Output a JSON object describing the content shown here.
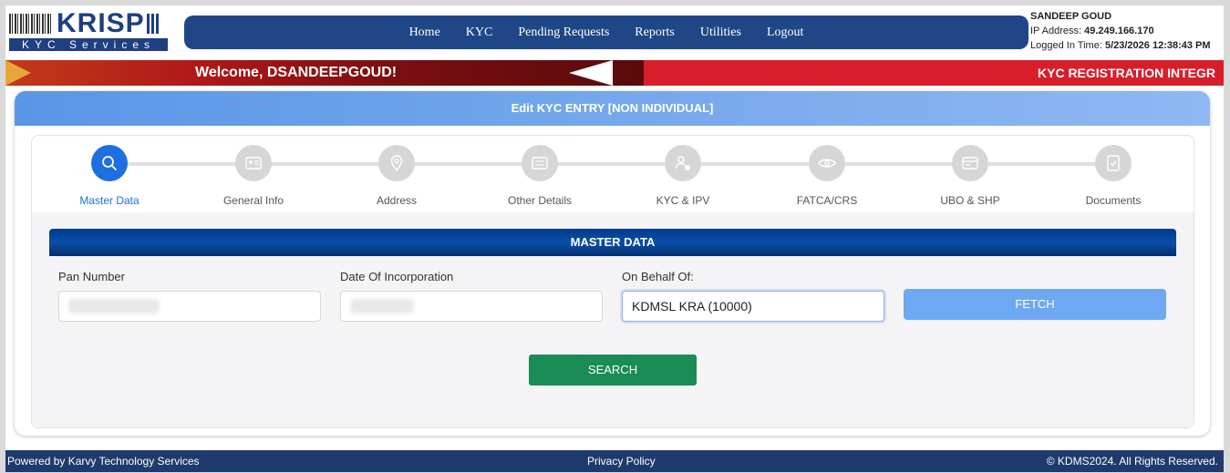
{
  "brand": {
    "logo_word": "KRISP",
    "logo_sub": "KYC Services"
  },
  "nav": {
    "items": [
      {
        "label": "Home"
      },
      {
        "label": "KYC"
      },
      {
        "label": "Pending Requests"
      },
      {
        "label": "Reports"
      },
      {
        "label": "Utilities"
      },
      {
        "label": "Logout"
      }
    ]
  },
  "user": {
    "name": "SANDEEP GOUD",
    "ip_label": "IP Address:",
    "ip_value": "49.249.166.170",
    "login_label": "Logged In Time:",
    "login_value": "5/23/2026 12:38:43 PM"
  },
  "banner": {
    "welcome": "Welcome, DSANDEEPGOUD!",
    "marquee": "KYC REGISTRATION INTEGR"
  },
  "page": {
    "title": "Edit KYC ENTRY [NON INDIVIDUAL]"
  },
  "steps": [
    {
      "label": "Master Data",
      "icon": "search-icon",
      "active": true
    },
    {
      "label": "General Info",
      "icon": "id-card-icon",
      "active": false
    },
    {
      "label": "Address",
      "icon": "location-pin-icon",
      "active": false
    },
    {
      "label": "Other Details",
      "icon": "list-icon",
      "active": false
    },
    {
      "label": "KYC & IPV",
      "icon": "user-check-icon",
      "active": false
    },
    {
      "label": "FATCA/CRS",
      "icon": "eye-icon",
      "active": false
    },
    {
      "label": "UBO & SHP",
      "icon": "card-icon",
      "active": false
    },
    {
      "label": "Documents",
      "icon": "document-check-icon",
      "active": false
    }
  ],
  "section": {
    "title": "MASTER DATA"
  },
  "form": {
    "pan_label": "Pan Number",
    "pan_value": "",
    "doi_label": "Date Of Incorporation",
    "doi_value": "",
    "behalf_label": "On Behalf Of:",
    "behalf_value": "KDMSL KRA (10000)",
    "fetch_label": "FETCH",
    "search_label": "SEARCH"
  },
  "footer": {
    "left": "Powered by Karvy Technology Services",
    "center": "Privacy Policy",
    "right": "© KDMS2024. All Rights Reserved."
  },
  "colors": {
    "nav_bg": "#1f4788",
    "active_step": "#1f6fe0",
    "search_button": "#1a8c55",
    "fetch_button": "#6ea8f2",
    "banner_red": "#d81e2b",
    "footer_bg": "#1f3b6e"
  }
}
